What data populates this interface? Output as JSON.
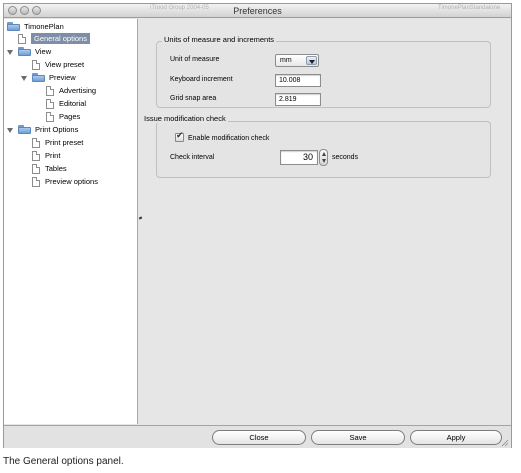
{
  "window": {
    "title": "Preferences",
    "ghost_left": "iTrood Group 2004-05",
    "ghost_right": "TimonePlanStandalone"
  },
  "sidebar": {
    "items": [
      {
        "label": "TimonePlan",
        "icon": "folder-icon",
        "expanded": true
      },
      {
        "label": "General options",
        "icon": "document-icon",
        "selected": true
      },
      {
        "label": "View",
        "icon": "folder-icon",
        "expanded": true
      },
      {
        "label": "View preset",
        "icon": "document-icon"
      },
      {
        "label": "Preview",
        "icon": "folder-icon",
        "expanded": true
      },
      {
        "label": "Advertising",
        "icon": "document-icon"
      },
      {
        "label": "Editorial",
        "icon": "document-icon"
      },
      {
        "label": "Pages",
        "icon": "document-icon"
      },
      {
        "label": "Print Options",
        "icon": "folder-icon",
        "expanded": true
      },
      {
        "label": "Print preset",
        "icon": "document-icon"
      },
      {
        "label": "Print",
        "icon": "document-icon"
      },
      {
        "label": "Tables",
        "icon": "document-icon"
      },
      {
        "label": "Preview options",
        "icon": "document-icon"
      }
    ]
  },
  "units_group": {
    "title": "Units of measure and increments",
    "unit_of_measure_label": "Unit of measure",
    "unit_of_measure_value": "mm",
    "keyboard_increment_label": "Keyboard increment",
    "keyboard_increment_value": "10.008",
    "grid_snap_label": "Grid snap area",
    "grid_snap_value": "2.819"
  },
  "modification_group": {
    "title": "Issue modification check",
    "enable_label": "Enable modification check",
    "enable_checked": true,
    "interval_label": "Check interval",
    "interval_value": "30",
    "interval_unit": "seconds"
  },
  "footer": {
    "close_label": "Close",
    "save_label": "Save",
    "apply_label": "Apply"
  },
  "caption": "The General options panel.",
  "colors": {
    "selection": "#7d8ea8",
    "folder": "#6f9fd6",
    "panel": "#e6e6e6"
  }
}
